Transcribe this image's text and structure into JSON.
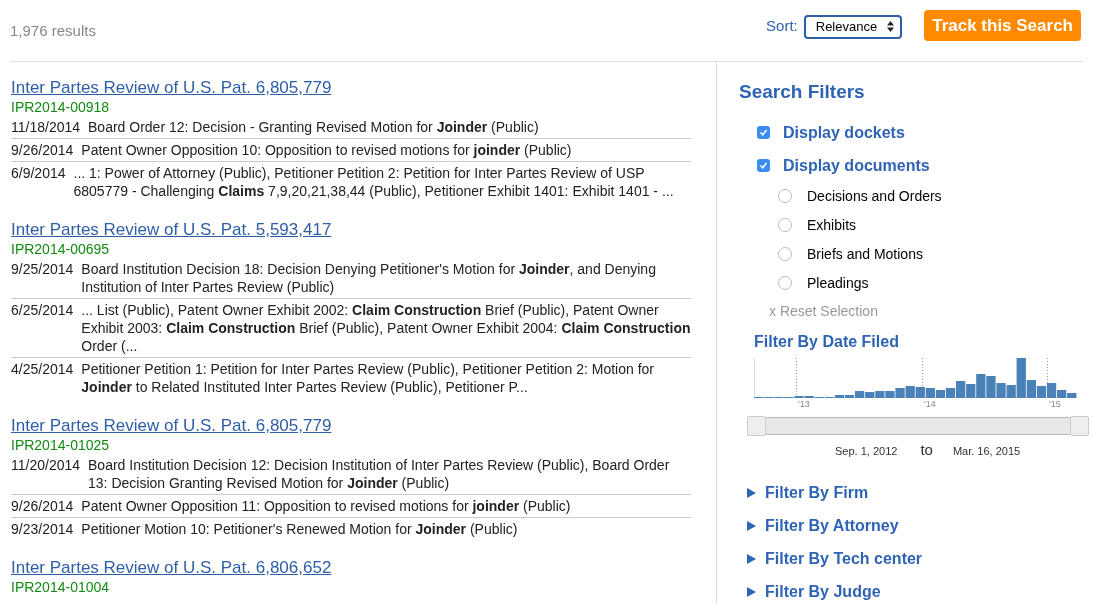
{
  "results_count": "1,976 results",
  "sort": {
    "label": "Sort:",
    "value": "Relevance"
  },
  "track_button": "Track this Search",
  "results": [
    {
      "title": "Inter Partes Review of U.S. Pat. 6,805,779",
      "id": "IPR2014-00918",
      "documents": [
        {
          "date": "11/18/2014",
          "text": "Board Order 12: Decision - Granting Revised Motion for **Joinder** (Public)"
        },
        {
          "date": "9/26/2014",
          "text": "Patent Owner Opposition 10: Opposition to revised motions for **joinder** (Public)"
        },
        {
          "date": "6/9/2014",
          "text": "... 1: Power of Attorney (Public), Petitioner Petition 2: Petition for Inter Partes Review of USP 6805779 - Challenging **Claims** 7,9,20,21,38,44 (Public), Petitioner Exhibit 1401: Exhibit 1401 - ..."
        }
      ]
    },
    {
      "title": "Inter Partes Review of U.S. Pat. 5,593,417",
      "id": "IPR2014-00695",
      "documents": [
        {
          "date": "9/25/2014",
          "text": "Board Institution Decision 18: Decision Denying Petitioner's Motion for **Joinder**, and Denying Institution of Inter Partes Review (Public)"
        },
        {
          "date": "6/25/2014",
          "text": "... List (Public), Patent Owner Exhibit 2002: **Claim Construction** Brief (Public), Patent Owner Exhibit 2003: **Claim Construction** Brief (Public), Patent Owner Exhibit 2004: **Claim Construction** Order (..."
        },
        {
          "date": "4/25/2014",
          "text": "Petitioner Petition 1: Petition for Inter Partes Review (Public), Petitioner Petition 2: Motion for **Joinder** to Related Instituted Inter Partes Review (Public), Petitioner P..."
        }
      ]
    },
    {
      "title": "Inter Partes Review of U.S. Pat. 6,805,779",
      "id": "IPR2014-01025",
      "documents": [
        {
          "date": "11/20/2014",
          "text": "Board Institution Decision 12: Decision Institution of Inter Partes Review (Public), Board Order 13: Decision Granting Revised Motion for **Joinder** (Public)"
        },
        {
          "date": "9/26/2014",
          "text": "Patent Owner Opposition 11: Opposition to revised motions for **joinder** (Public)"
        },
        {
          "date": "9/23/2014",
          "text": "Petitioner Motion 10: Petitioner's Renewed Motion for **Joinder** (Public)"
        }
      ]
    },
    {
      "title": "Inter Partes Review of U.S. Pat. 6,806,652",
      "id": "IPR2014-01004"
    }
  ],
  "filters": {
    "title": "Search Filters",
    "checkboxes": [
      {
        "label": "Display dockets",
        "checked": true
      },
      {
        "label": "Display documents",
        "checked": true
      }
    ],
    "document_types": [
      {
        "label": "Decisions and Orders",
        "selected": false
      },
      {
        "label": "Exhibits",
        "selected": false
      },
      {
        "label": "Briefs and Motions",
        "selected": false
      },
      {
        "label": "Pleadings",
        "selected": false
      }
    ],
    "reset": "x Reset Selection",
    "date_filter": {
      "title": "Filter By Date Filed",
      "axis_labels": [
        "'13",
        "'14",
        "'15"
      ],
      "from": "Sep. 1, 2012",
      "separator": "to",
      "to": "Mar. 16, 2015"
    },
    "sections": [
      {
        "label": "Filter By Firm",
        "expanded": false
      },
      {
        "label": "Filter By Attorney",
        "expanded": false
      },
      {
        "label": "Filter By Tech center",
        "expanded": false
      },
      {
        "label": "Filter By Judge",
        "expanded": false
      }
    ]
  }
}
